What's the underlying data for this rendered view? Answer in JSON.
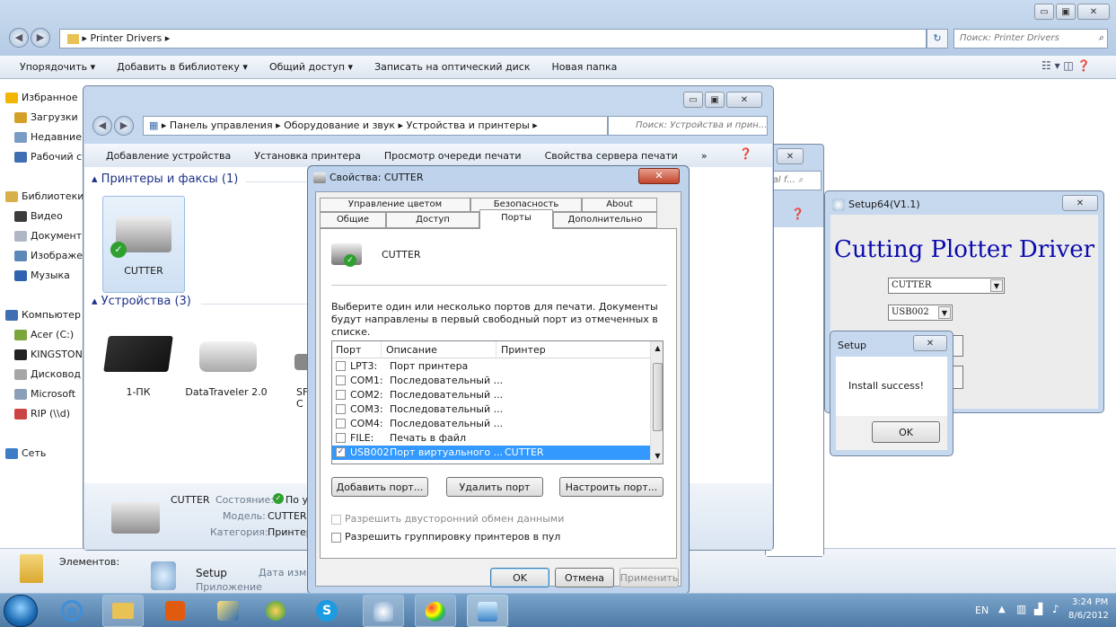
{
  "explorer": {
    "breadcrumb": "Printer Drivers",
    "search_placeholder": "Поиск: Printer Drivers",
    "toolbar": [
      "Упорядочить ▾",
      "Добавить в библиотеку ▾",
      "Общий доступ ▾",
      "Записать на оптический диск",
      "Новая папка"
    ],
    "sidebar": [
      "Избранное",
      "Загрузки",
      "Недавние места",
      "Рабочий стол",
      "",
      "Библиотеки",
      "Видео",
      "Документы",
      "Изображения",
      "Музыка",
      "",
      "Компьютер",
      "Acer (C:)",
      "KINGSTON",
      "Дисковод",
      "Microsoft",
      "RIP (\\\\d)",
      "",
      "Сеть"
    ],
    "details_label": "Элементов:",
    "setup_name": "Setup",
    "setup_type": "Приложение",
    "setup_date_label": "Дата изме"
  },
  "devices": {
    "breadcrumb": [
      "Панель управления",
      "Оборудование и звук",
      "Устройства и принтеры"
    ],
    "search_placeholder": "Поиск: Устройства и прин...",
    "toolbar": [
      "Добавление устройства",
      "Установка принтера",
      "Просмотр очереди печати",
      "Свойства сервера печати",
      "»"
    ],
    "group_printers": "Принтеры и факсы (1)",
    "printer_name": "CUTTER",
    "group_devices": "Устройства (3)",
    "devices": [
      "1-ПК",
      "DataTraveler 2.0",
      "SF\nC"
    ],
    "details_name": "CUTTER",
    "details_state_label": "Состояние:",
    "details_state_value": "По у",
    "details_model_label": "Модель:",
    "details_model_value": "CUTTER",
    "details_category_label": "Категория:",
    "details_category_value": "Принтер"
  },
  "behind_window": {
    "search_fragment": "ial f..."
  },
  "props": {
    "title": "Свойства: CUTTER",
    "tabs_back": [
      "Управление цветом",
      "Безопасность",
      "About"
    ],
    "tabs_front": [
      "Общие",
      "Доступ",
      "Порты",
      "Дополнительно"
    ],
    "printer_name": "CUTTER",
    "description": "Выберите один или несколько портов для печати. Документы будут направлены в первый свободный порт из отмеченных в списке.",
    "columns": [
      "Порт",
      "Описание",
      "Принтер"
    ],
    "ports": [
      {
        "port": "LPT3:",
        "desc": "Порт принтера",
        "printer": "",
        "checked": false
      },
      {
        "port": "COM1:",
        "desc": "Последовательный ...",
        "printer": "",
        "checked": false
      },
      {
        "port": "COM2:",
        "desc": "Последовательный ...",
        "printer": "",
        "checked": false
      },
      {
        "port": "COM3:",
        "desc": "Последовательный ...",
        "printer": "",
        "checked": false
      },
      {
        "port": "COM4:",
        "desc": "Последовательный ...",
        "printer": "",
        "checked": false
      },
      {
        "port": "FILE:",
        "desc": "Печать в файл",
        "printer": "",
        "checked": false
      },
      {
        "port": "USB002",
        "desc": "Порт виртуального ...",
        "printer": "CUTTER",
        "checked": true
      }
    ],
    "add_port": "Добавить порт...",
    "delete_port": "Удалить порт",
    "configure_port": "Настроить порт...",
    "bidirectional": "Разрешить двусторонний обмен данными",
    "pooling": "Разрешить группировку принтеров в пул",
    "ok": "OK",
    "cancel": "Отмена",
    "apply": "Применить"
  },
  "setup64": {
    "title": "Setup64(V1.1)",
    "heading": "Cutting Plotter Driver",
    "model_value": "CUTTER",
    "port_value": "USB002"
  },
  "setup_msg": {
    "title": "Setup",
    "message": "Install success!",
    "ok": "OK"
  },
  "taskbar": {
    "lang": "EN",
    "time": "3:24 PM",
    "date": "8/6/2012"
  }
}
